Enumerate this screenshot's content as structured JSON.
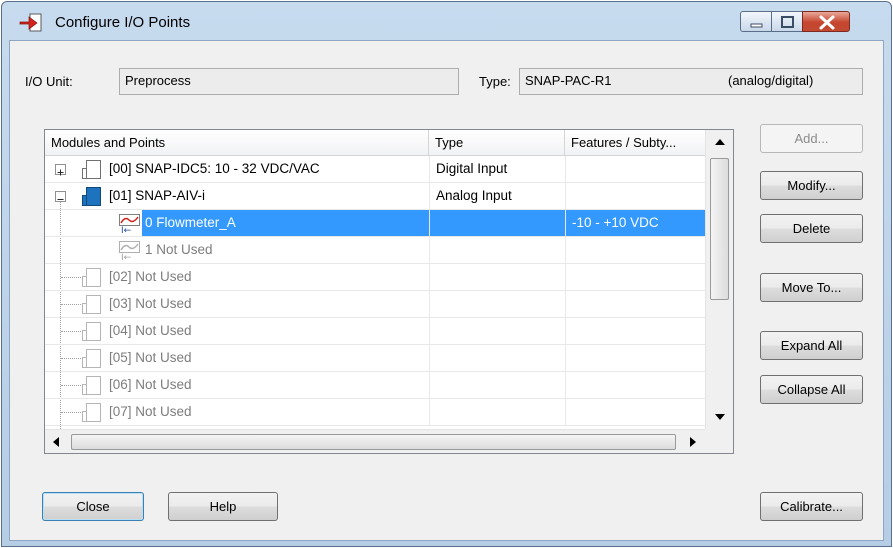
{
  "window": {
    "title": "Configure I/O Points"
  },
  "io_unit": {
    "label": "I/O Unit:",
    "value": "Preprocess"
  },
  "type": {
    "label": "Type:",
    "value": "SNAP-PAC-R1",
    "subvalue": "(analog/digital)"
  },
  "list": {
    "columns": [
      "Modules and Points",
      "Type",
      "Features / Subty..."
    ],
    "rows": [
      {
        "text": "[00] SNAP-IDC5: 10 - 32 VDC/VAC",
        "type": "Digital Input",
        "feature": "",
        "kind": "module",
        "state": "collapsed"
      },
      {
        "text": "[01] SNAP-AIV-i",
        "type": "Analog Input",
        "feature": "",
        "kind": "module-active",
        "state": "expanded"
      },
      {
        "text": "0  Flowmeter_A",
        "type": "",
        "feature": "-10 - +10 VDC",
        "kind": "point-selected"
      },
      {
        "text": "1  Not Used",
        "type": "",
        "feature": "",
        "kind": "point-unused"
      },
      {
        "text": "[02] Not Used",
        "type": "",
        "feature": "",
        "kind": "module-empty"
      },
      {
        "text": "[03] Not Used",
        "type": "",
        "feature": "",
        "kind": "module-empty"
      },
      {
        "text": "[04] Not Used",
        "type": "",
        "feature": "",
        "kind": "module-empty"
      },
      {
        "text": "[05] Not Used",
        "type": "",
        "feature": "",
        "kind": "module-empty"
      },
      {
        "text": "[06] Not Used",
        "type": "",
        "feature": "",
        "kind": "module-empty"
      },
      {
        "text": "[07] Not Used",
        "type": "",
        "feature": "",
        "kind": "module-empty"
      }
    ]
  },
  "buttons": {
    "add": "Add...",
    "modify": "Modify...",
    "delete": "Delete",
    "move_to": "Move To...",
    "expand_all": "Expand All",
    "collapse_all": "Collapse All",
    "close": "Close",
    "help": "Help",
    "calibrate": "Calibrate..."
  },
  "colors": {
    "selection": "#3399ff",
    "accent_blue": "#1e73be",
    "close_red": "#c6452e"
  },
  "icons": [
    "app-icon",
    "module-icon",
    "analog-point-icon",
    "minimize-icon",
    "maximize-icon",
    "close-icon"
  ]
}
